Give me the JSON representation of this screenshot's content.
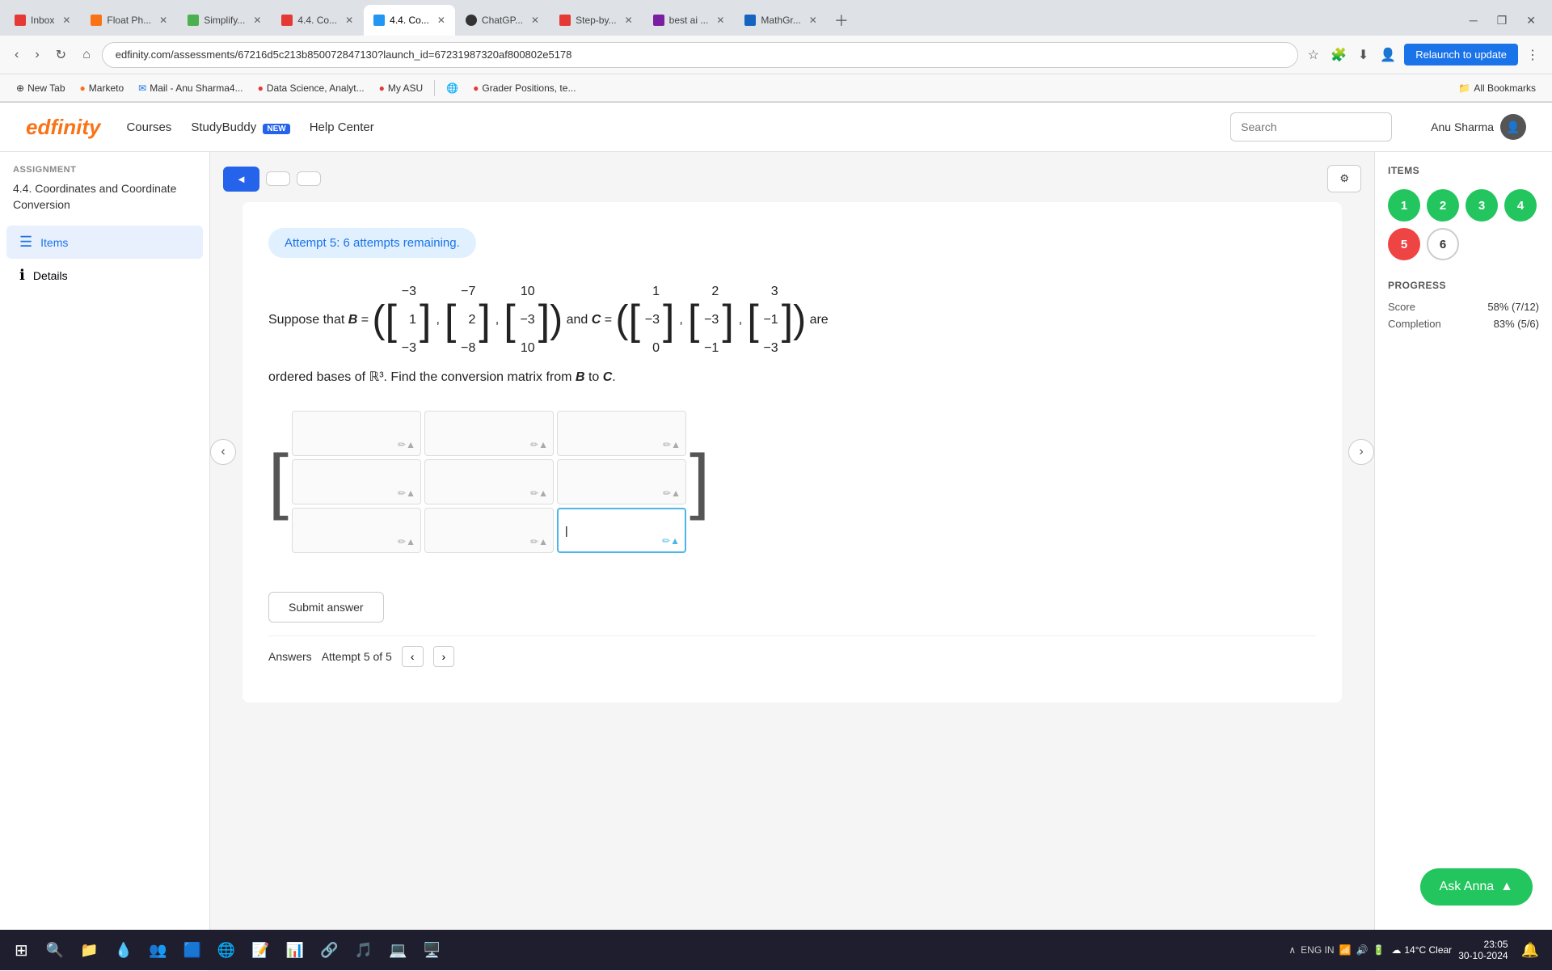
{
  "browser": {
    "tabs": [
      {
        "id": "inbox",
        "favicon_color": "#e53935",
        "label": "Inbox",
        "active": false
      },
      {
        "id": "float",
        "favicon_color": "#f97316",
        "label": "Float Ph...",
        "active": false
      },
      {
        "id": "simplify",
        "favicon_color": "#4caf50",
        "label": "Simplify...",
        "active": false
      },
      {
        "id": "44coord1",
        "favicon_color": "#e53935",
        "label": "4.4. Co...",
        "active": false
      },
      {
        "id": "44coord2",
        "favicon_color": "#2196f3",
        "label": "4.4. Co...",
        "active": true
      },
      {
        "id": "chatgpt",
        "favicon_color": "#333",
        "label": "ChatGP...",
        "active": false
      },
      {
        "id": "stepby",
        "favicon_color": "#e53935",
        "label": "Step-by...",
        "active": false
      },
      {
        "id": "bestai",
        "favicon_color": "#7b1fa2",
        "label": "best ai ...",
        "active": false
      },
      {
        "id": "mathgr",
        "favicon_color": "#1565c0",
        "label": "MathGr...",
        "active": false
      }
    ],
    "address": "edfinity.com/assessments/67216d5c213b850072847130?launch_id=67231987320af800802e5178",
    "relaunch_label": "Relaunch to update",
    "bookmarks": [
      {
        "label": "New Tab",
        "icon": "⊕"
      },
      {
        "label": "Marketo",
        "icon": "●"
      },
      {
        "label": "Mail - Anu Sharma4...",
        "icon": "✉"
      },
      {
        "label": "Data Science, Analyt...",
        "icon": "●"
      },
      {
        "label": "My ASU",
        "icon": "●"
      },
      {
        "label": "",
        "icon": "🌐"
      },
      {
        "label": "Grader Positions, te...",
        "icon": "●"
      }
    ],
    "all_bookmarks_label": "All Bookmarks"
  },
  "nav": {
    "logo": "edfinity",
    "links": [
      {
        "label": "Courses"
      },
      {
        "label": "StudyBuddy",
        "badge": "NEW"
      },
      {
        "label": "Help Center"
      }
    ],
    "search_placeholder": "Search",
    "user_name": "Anu Sharma"
  },
  "sidebar": {
    "assignment_label": "ASSIGNMENT",
    "assignment_title": "4.4. Coordinates and Coordinate Conversion",
    "items": [
      {
        "label": "Items",
        "icon": "☰",
        "active": true
      },
      {
        "label": "Details",
        "icon": "ℹ",
        "active": false
      }
    ]
  },
  "content": {
    "top_nav": [
      {
        "label": "◄",
        "type": "blue"
      },
      {
        "label": "►",
        "type": "outline"
      },
      {
        "label": "",
        "type": "outline"
      }
    ],
    "attempt_banner": "Attempt 5: 6 attempts remaining.",
    "problem_text_parts": {
      "intro": "Suppose that ",
      "B_eq": "B =",
      "matrix_B": [
        [
          -3,
          -7,
          10
        ],
        [
          1,
          2,
          -3
        ],
        [
          -3,
          -8,
          10
        ]
      ],
      "and_C": "and C =",
      "matrix_C": [
        [
          1,
          2,
          3
        ],
        [
          -3,
          -3,
          -1
        ],
        [
          0,
          -1,
          -3
        ]
      ],
      "conclusion": "are ordered bases of ℝ³. Find the conversion matrix from B to C."
    },
    "matrix_cells": [
      [
        "",
        "",
        ""
      ],
      [
        "",
        "",
        ""
      ],
      [
        "",
        "",
        ""
      ]
    ],
    "submit_button": "Submit answer",
    "answers_label": "Answers",
    "attempt_label": "Attempt 5 of 5"
  },
  "items_panel": {
    "title": "ITEMS",
    "bubbles": [
      {
        "num": 1,
        "state": "green"
      },
      {
        "num": 2,
        "state": "green"
      },
      {
        "num": 3,
        "state": "green"
      },
      {
        "num": 4,
        "state": "green"
      },
      {
        "num": 5,
        "state": "red"
      },
      {
        "num": 6,
        "state": "outline"
      }
    ],
    "progress_title": "PROGRESS",
    "score_label": "Score",
    "score_value": "58% (7/12)",
    "completion_label": "Completion",
    "completion_value": "83% (5/6)"
  },
  "ask_anna": {
    "label": "Ask Anna",
    "icon": "▲"
  },
  "taskbar": {
    "weather": "14°C Clear",
    "time": "23:05",
    "date": "30-10-2024",
    "language": "ENG IN",
    "icons": [
      "🪟",
      "🔍",
      "📁",
      "💧",
      "📦",
      "👥",
      "🟦",
      "⚽",
      "📝",
      "📊",
      "🔗",
      "🎵",
      "💻",
      "🌐",
      "🖥️"
    ]
  }
}
